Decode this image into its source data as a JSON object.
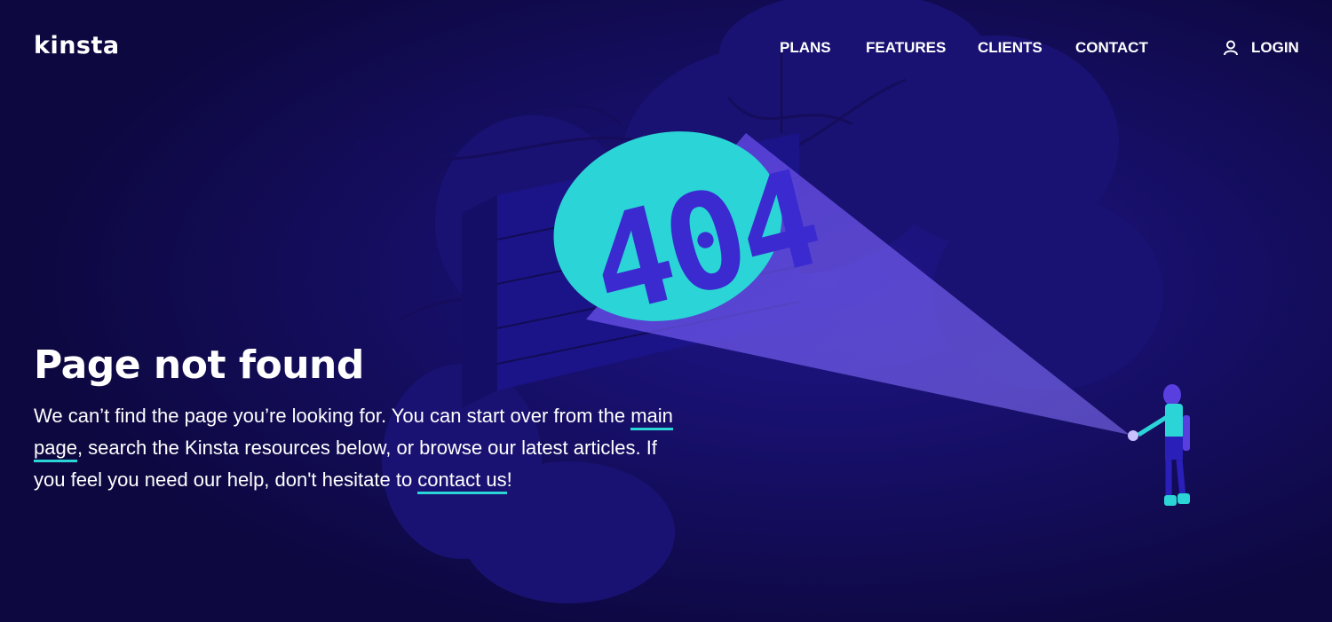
{
  "brand": {
    "logo_text": "kinsta"
  },
  "nav": {
    "items": [
      {
        "label": "PLANS"
      },
      {
        "label": "FEATURES"
      },
      {
        "label": "CLIENTS"
      },
      {
        "label": "CONTACT"
      }
    ],
    "login_label": "LOGIN",
    "login_icon": "user-icon"
  },
  "illustration": {
    "sign_text": "404"
  },
  "hero": {
    "title": "Page not found",
    "text_before": "We can’t find the page you’re looking for. You can start over from the ",
    "link_main": "main page",
    "text_middle": ", search the Kinsta resources below, or browse our latest articles. If you feel you need our help, don't hesitate to ",
    "link_contact": "contact us",
    "text_after": "!"
  },
  "colors": {
    "background": "#0d0840",
    "accent": "#2bd4d6",
    "beam": "#5a3fe0",
    "text": "#ffffff"
  }
}
